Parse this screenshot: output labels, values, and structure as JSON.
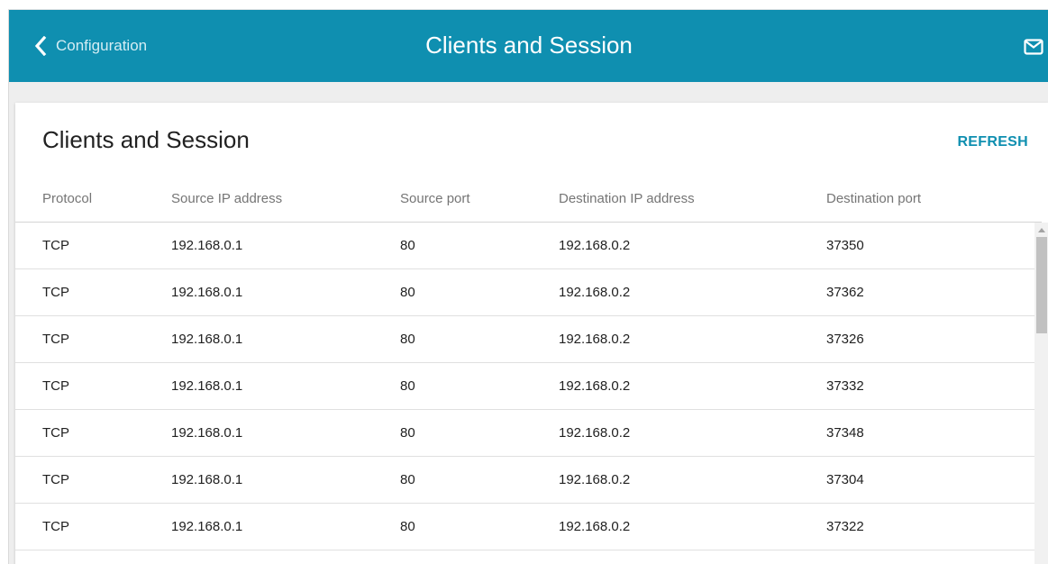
{
  "header": {
    "back_label": "Configuration",
    "title": "Clients and Session",
    "back_icon": "chevron-left-icon",
    "mail_icon": "mail-icon"
  },
  "card": {
    "title": "Clients and Session",
    "refresh_label": "REFRESH"
  },
  "table": {
    "columns": [
      "Protocol",
      "Source IP address",
      "Source port",
      "Destination IP address",
      "Destination port"
    ],
    "rows": [
      [
        "TCP",
        "192.168.0.1",
        "80",
        "192.168.0.2",
        "37350"
      ],
      [
        "TCP",
        "192.168.0.1",
        "80",
        "192.168.0.2",
        "37362"
      ],
      [
        "TCP",
        "192.168.0.1",
        "80",
        "192.168.0.2",
        "37326"
      ],
      [
        "TCP",
        "192.168.0.1",
        "80",
        "192.168.0.2",
        "37332"
      ],
      [
        "TCP",
        "192.168.0.1",
        "80",
        "192.168.0.2",
        "37348"
      ],
      [
        "TCP",
        "192.168.0.1",
        "80",
        "192.168.0.2",
        "37304"
      ],
      [
        "TCP",
        "192.168.0.1",
        "80",
        "192.168.0.2",
        "37322"
      ]
    ]
  },
  "colors": {
    "accent": "#0f8fb0",
    "background": "#eeeeee"
  }
}
